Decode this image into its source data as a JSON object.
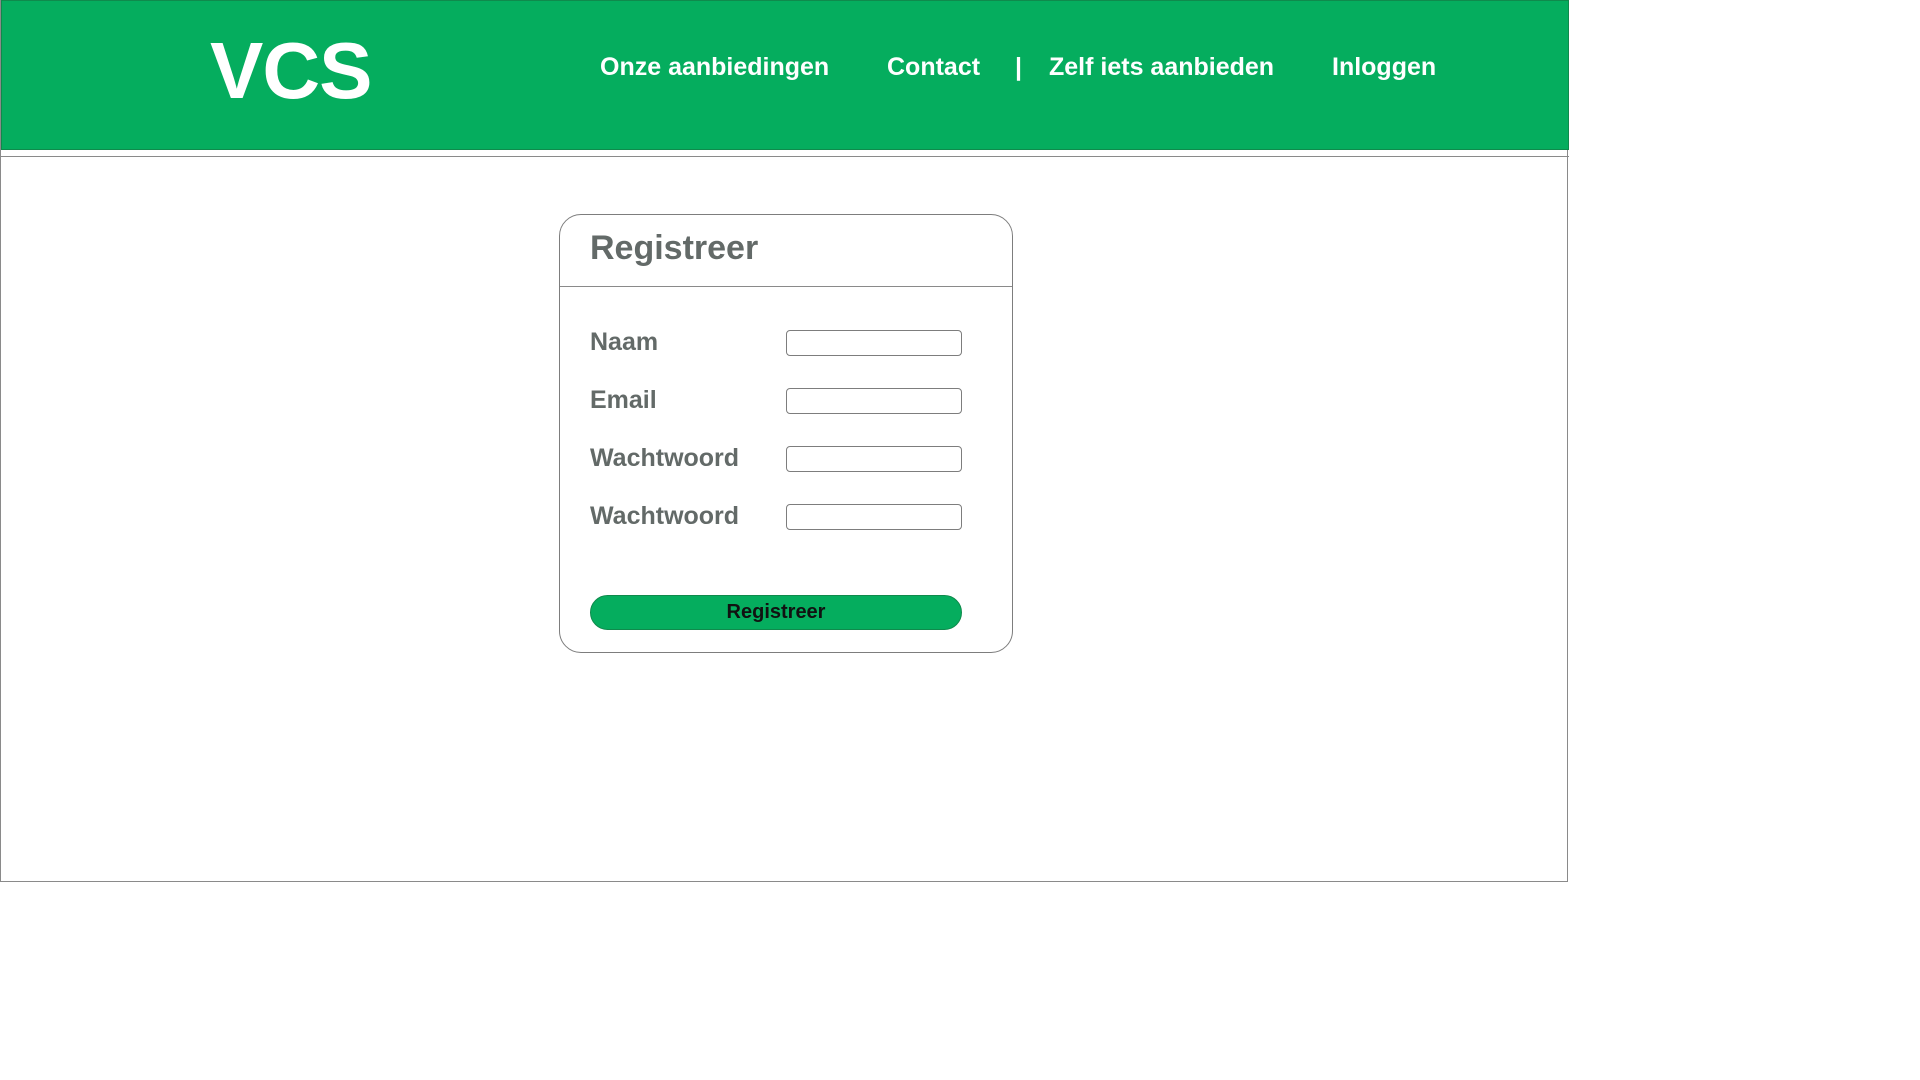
{
  "header": {
    "logo": "VCS",
    "nav": {
      "offers": "Onze aanbiedingen",
      "contact": "Contact",
      "separator": "|",
      "offer_yourself": "Zelf iets aanbieden",
      "login": "Inloggen"
    }
  },
  "register": {
    "title": "Registreer",
    "fields": [
      {
        "label": "Naam",
        "value": "",
        "placeholder": ""
      },
      {
        "label": "Email",
        "value": "",
        "placeholder": ""
      },
      {
        "label": "Wachtwoord",
        "value": "",
        "placeholder": ""
      },
      {
        "label": "Wachtwoord",
        "value": "",
        "placeholder": ""
      }
    ],
    "submit_label": "Registreer"
  },
  "colors": {
    "brand_green": "#05ad5e",
    "label_gray": "#636a68",
    "border_gray": "#7d7d7d"
  }
}
